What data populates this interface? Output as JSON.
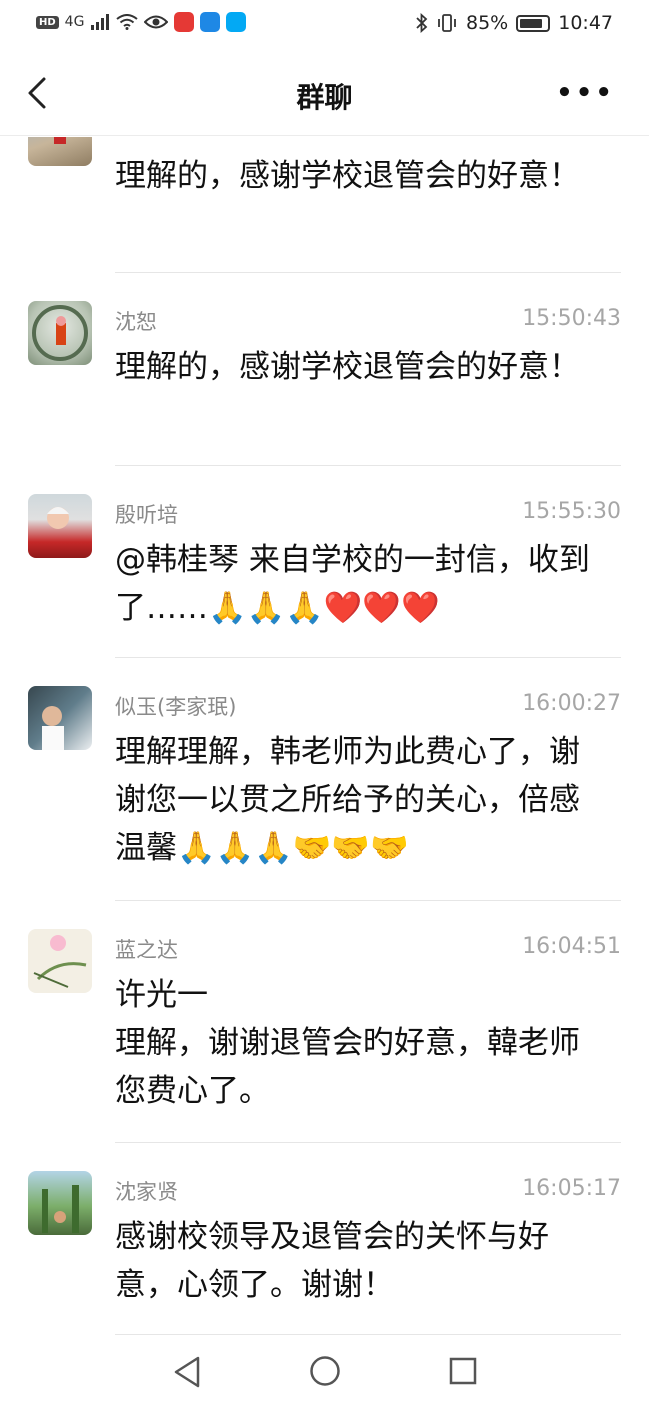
{
  "status_bar": {
    "network": "4G",
    "battery_percent": "85%",
    "time": "10:47",
    "battery_level": 0.85
  },
  "header": {
    "title": "群聊"
  },
  "messages": [
    {
      "sender": "",
      "time": "",
      "text": "理解的，感谢学校退管会的好意！"
    },
    {
      "sender": "沈恕",
      "time": "15:50:43",
      "text": "理解的，感谢学校退管会的好意！"
    },
    {
      "sender": "殷听培",
      "time": "15:55:30",
      "text": "@韩桂琴 来自学校的一封信，收到了……🙏🙏🙏❤️❤️❤️"
    },
    {
      "sender": "似玉(李家珉)",
      "time": "16:00:27",
      "text": "理解理解，韩老师为此费心了，谢谢您一以贯之所给予的关心，倍感温馨🙏🙏🙏🤝🤝🤝"
    },
    {
      "sender": "蓝之达",
      "time": "16:04:51",
      "text": "许光一\n理解，谢谢退管会旳好意，韓老师您费心了。"
    },
    {
      "sender": "沈家贤",
      "time": "16:05:17",
      "text": "感谢校领导及退管会的关怀与好意，心领了。谢谢！"
    }
  ],
  "icons": {
    "back": "chevron-left-icon",
    "more": "more-dots-icon",
    "nav_back": "triangle-back-icon",
    "nav_home": "circle-home-icon",
    "nav_recent": "square-recent-icon"
  },
  "colors": {
    "sender_name": "#8a8a8a",
    "timestamp": "#a6a6a6",
    "divider": "#e6e6e6"
  }
}
